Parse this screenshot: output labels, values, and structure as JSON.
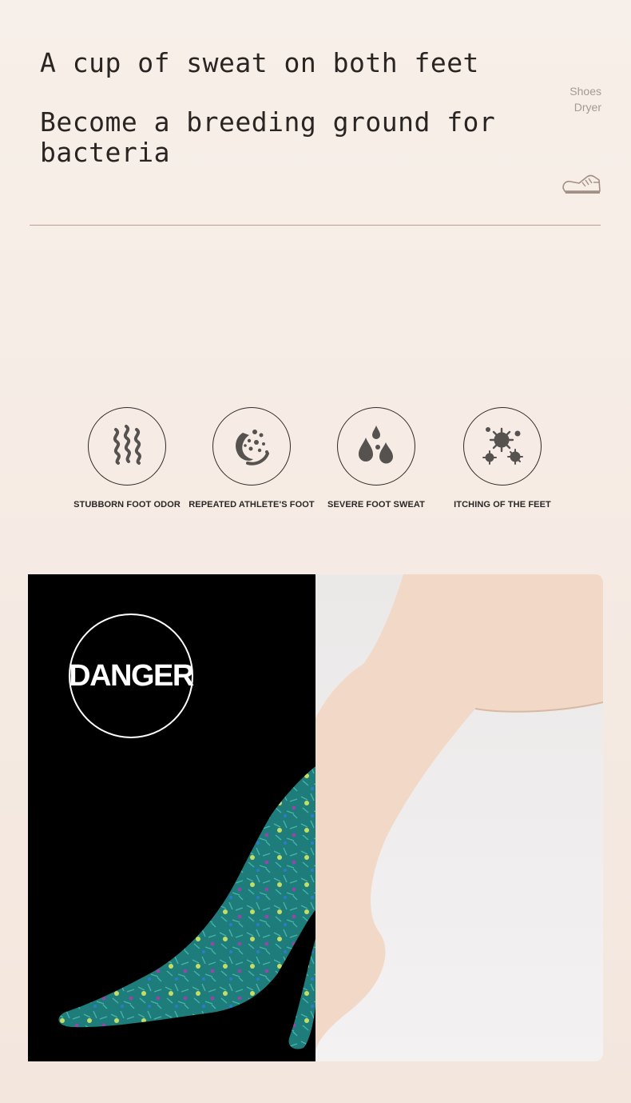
{
  "hero": {
    "line1": "A cup of sweat on both feet",
    "line2": "Become a breeding ground for",
    "line3": "bacteria"
  },
  "brand": {
    "line1": "Shoes",
    "line2": "Dryer",
    "icon": "sneaker-icon"
  },
  "problems": [
    {
      "icon": "odor-waves-icon",
      "label": "STUBBORN FOOT ODOR"
    },
    {
      "icon": "fungus-bacteria-icon",
      "label": "REPEATED ATHLETE'S FOOT"
    },
    {
      "icon": "sweat-drops-icon",
      "label": "SEVERE FOOT SWEAT"
    },
    {
      "icon": "germs-icon",
      "label": "ITCHING OF THE FEET"
    }
  ],
  "comparison": {
    "badge": "DANGER"
  },
  "colors": {
    "icon_gray": "#555250",
    "divider": "#b89f93",
    "bacteria_teal": "#1e7c7a",
    "skin": "#f2d8c6"
  }
}
